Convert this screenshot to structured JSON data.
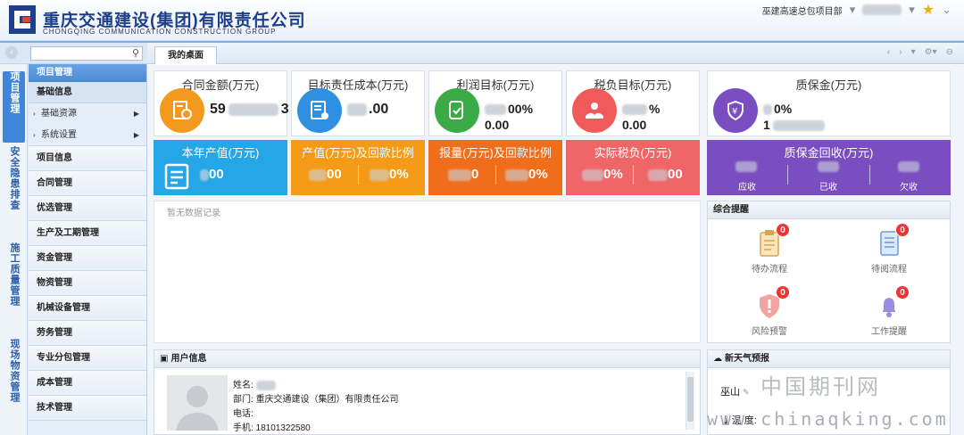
{
  "brand": {
    "name_cn": "重庆交通建设(集团)有限责任公司",
    "name_en": "CHONGQING COMMUNICATION CONSTRUCTION GROUP"
  },
  "header": {
    "project": "巫建高速总包项目部"
  },
  "sidebar": {
    "vertical_tabs": [
      "项目管理",
      "安全隐患排查",
      "施工质量管理",
      "现场物资管理"
    ],
    "menu_title": "项目管理",
    "sub_header": "基础信息",
    "children": [
      "基础资源",
      "系统设置"
    ],
    "items": [
      "项目信息",
      "合同管理",
      "优选管理",
      "生产及工期管理",
      "资金管理",
      "物资管理",
      "机械设备管理",
      "劳务管理",
      "专业分包管理",
      "成本管理",
      "技术管理"
    ]
  },
  "tabs": {
    "active": "我的桌面"
  },
  "stats": [
    {
      "title": "合同金额(万元)",
      "value1": "59",
      "value1_tail": "3",
      "value2": "",
      "color": "#f39a1e"
    },
    {
      "title": "目标责任成本(万元)",
      "value1": ".00",
      "value2": "",
      "color": "#2f8fe0"
    },
    {
      "title": "利润目标(万元)",
      "value1": "00%",
      "value2": "0.00",
      "color": "#3bab48"
    },
    {
      "title": "税负目标(万元)",
      "value1": "%",
      "value2": "0.00",
      "color": "#f05a5a"
    },
    {
      "title": "质保金(万元)",
      "value1": "0%",
      "value2": "1",
      "color": "#7a4ec0"
    }
  ],
  "stats2": [
    {
      "title": "本年产值(万元)",
      "a": "00",
      "color": "#25a6e6"
    },
    {
      "title": "产值(万元)及回款比例",
      "a": "00",
      "b": "0%",
      "color": "#f59a16"
    },
    {
      "title": "报量(万元)及回款比例",
      "a": "0",
      "b": "0%",
      "color": "#f06d1c"
    },
    {
      "title": "实际税负(万元)",
      "a": "0%",
      "b": "00",
      "color": "#f06567"
    },
    {
      "title": "质保金回收(万元)",
      "sub": [
        "应收",
        "已收",
        "欠收"
      ],
      "color": "#7a4ec0"
    }
  ],
  "records": {
    "empty": "暂无数据记录"
  },
  "reminders": {
    "title": "综合提醒",
    "items": [
      {
        "label": "待办流程",
        "count": "0"
      },
      {
        "label": "待阅流程",
        "count": "0"
      },
      {
        "label": "风险预警",
        "count": "0"
      },
      {
        "label": "工作提醒",
        "count": "0"
      }
    ]
  },
  "user": {
    "title": "用户信息",
    "name_label": "姓名:",
    "dept_label": "部门:",
    "dept_value": "重庆交通建设（集团）有限责任公司",
    "phone_label": "电话:",
    "mobile_label": "手机:",
    "mobile_value": "18101322580"
  },
  "weather": {
    "title": "新天气预报",
    "city": "巫山",
    "temp_label": "温  度:"
  },
  "watermark": {
    "cn": "中国期刊网",
    "url": "www.chinaqking.com"
  }
}
